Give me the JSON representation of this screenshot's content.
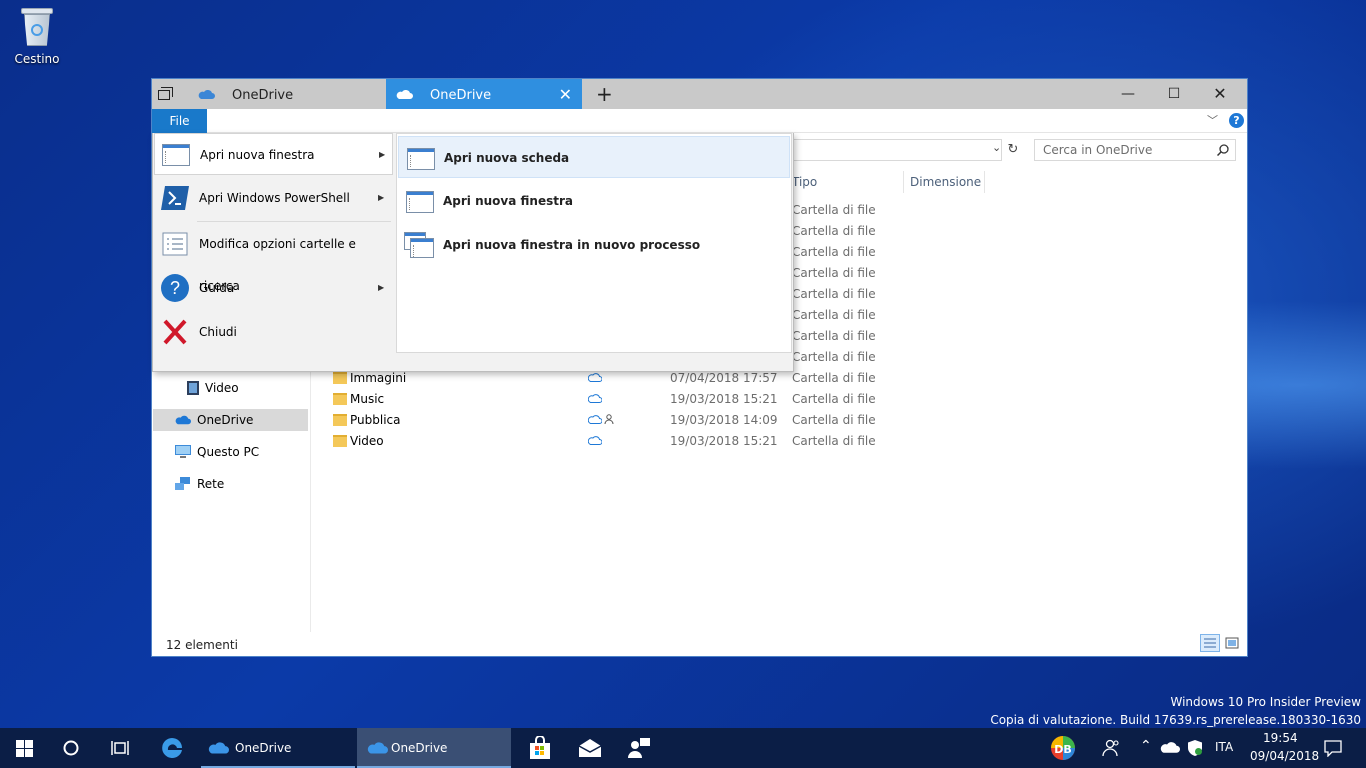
{
  "desktop": {
    "recycle_bin_label": "Cestino"
  },
  "explorer": {
    "tabs": [
      {
        "label": "OneDrive"
      },
      {
        "label": "OneDrive"
      }
    ],
    "file_tab_label": "File",
    "search_placeholder": "Cerca in OneDrive",
    "columns": {
      "type": "Tipo",
      "size": "Dimensione"
    },
    "hidden_rows_type": [
      "Cartella di file",
      "Cartella di file",
      "Cartella di file",
      "Cartella di file",
      "Cartella di file",
      "Cartella di file",
      "Cartella di file",
      "Cartella di file"
    ],
    "files": [
      {
        "name": "Immagini",
        "date": "07/04/2018 17:57",
        "type": "Cartella di file",
        "shared": false
      },
      {
        "name": "Music",
        "date": "19/03/2018 15:21",
        "type": "Cartella di file",
        "shared": false
      },
      {
        "name": "Pubblica",
        "date": "19/03/2018 14:09",
        "type": "Cartella di file",
        "shared": true
      },
      {
        "name": "Video",
        "date": "19/03/2018 15:21",
        "type": "Cartella di file",
        "shared": false
      }
    ],
    "nav": {
      "video": "Video",
      "onedrive": "OneDrive",
      "this_pc": "Questo PC",
      "network": "Rete"
    },
    "status": "12 elementi"
  },
  "file_menu": {
    "left_items": [
      {
        "label": "Apri nuova finestra",
        "icon": "window-icon"
      },
      {
        "label": "Apri Windows PowerShell",
        "icon": "powershell-icon"
      },
      {
        "label": "Modifica opzioni cartelle e ricerca",
        "icon": "options-icon"
      },
      {
        "label": "Guida",
        "icon": "help-icon"
      },
      {
        "label": "Chiudi",
        "icon": "close-icon"
      }
    ],
    "submenu_items": [
      {
        "label": "Apri nuova scheda"
      },
      {
        "label": "Apri nuova finestra"
      },
      {
        "label": "Apri nuova finestra in nuovo processo"
      }
    ]
  },
  "watermark": {
    "line1": "Windows 10 Pro Insider Preview",
    "line2": "Copia di valutazione. Build 17639.rs_prerelease.180330-1630"
  },
  "taskbar": {
    "apps": [
      {
        "label": "OneDrive"
      },
      {
        "label": "OneDrive"
      }
    ],
    "language": "ITA",
    "time": "19:54",
    "date": "09/04/2018"
  },
  "colors": {
    "accent": "#1979ca",
    "tab_active": "#2f8fe0",
    "taskbar": "#0b1e46"
  }
}
